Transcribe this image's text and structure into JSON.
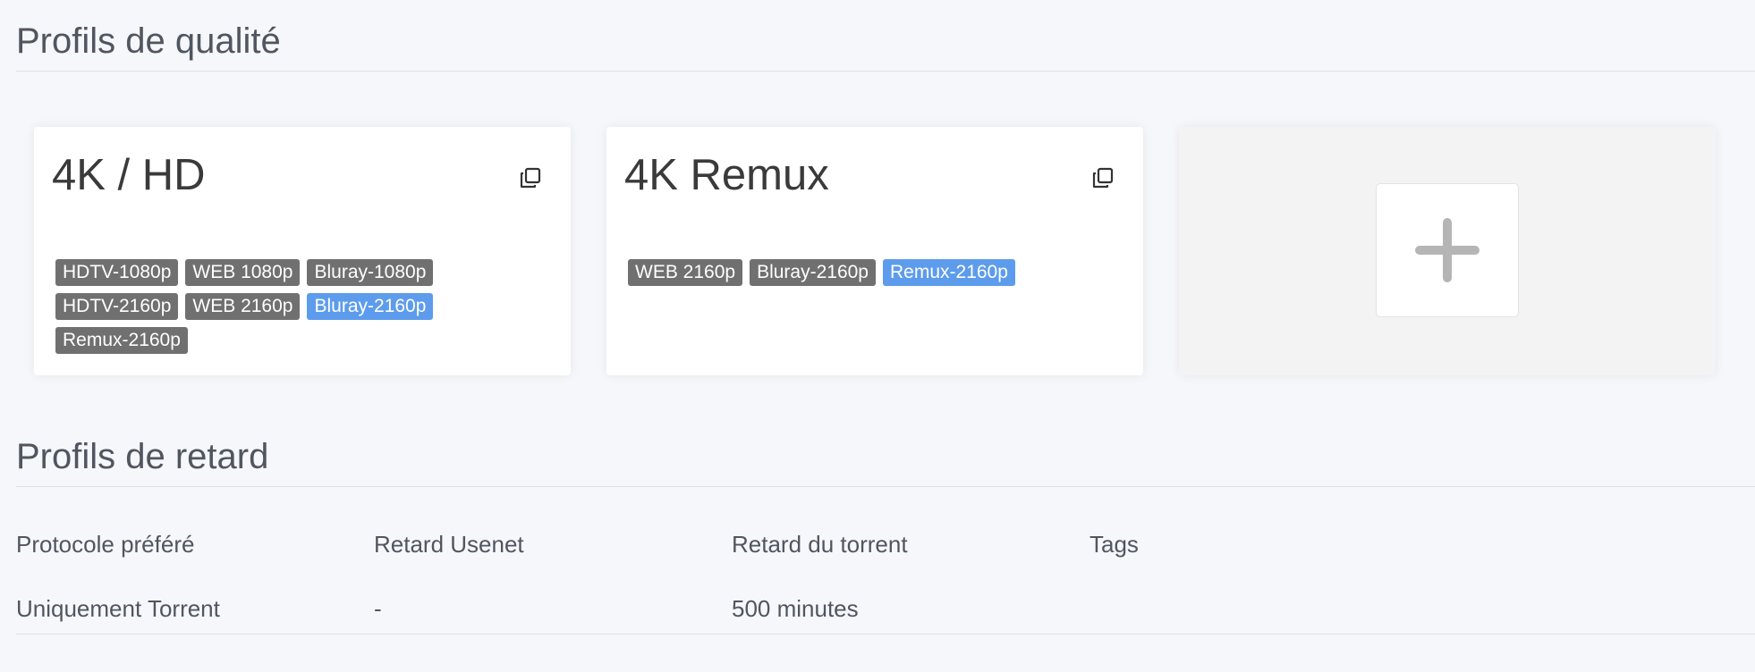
{
  "quality_profiles": {
    "title": "Profils de qualité",
    "cards": [
      {
        "name": "4K / HD",
        "clone_icon": "clone-icon",
        "qualities": [
          {
            "label": "HDTV-1080p",
            "cutoff": false
          },
          {
            "label": "WEB 1080p",
            "cutoff": false
          },
          {
            "label": "Bluray-1080p",
            "cutoff": false
          },
          {
            "label": "HDTV-2160p",
            "cutoff": false
          },
          {
            "label": "WEB 2160p",
            "cutoff": false
          },
          {
            "label": "Bluray-2160p",
            "cutoff": true
          },
          {
            "label": "Remux-2160p",
            "cutoff": false
          }
        ]
      },
      {
        "name": "4K Remux",
        "clone_icon": "clone-icon",
        "qualities": [
          {
            "label": "WEB 2160p",
            "cutoff": false
          },
          {
            "label": "Bluray-2160p",
            "cutoff": false
          },
          {
            "label": "Remux-2160p",
            "cutoff": true
          }
        ]
      }
    ],
    "add_icon": "plus-icon"
  },
  "delay_profiles": {
    "title": "Profils de retard",
    "columns": [
      "Protocole préféré",
      "Retard Usenet",
      "Retard du torrent",
      "Tags"
    ],
    "rows": [
      [
        "Uniquement Torrent",
        "-",
        "500 minutes",
        ""
      ]
    ]
  },
  "colors": {
    "background": "#f5f7fa",
    "tag_default": "#707070",
    "tag_cutoff": "#5d9cec",
    "text": "#505660"
  }
}
